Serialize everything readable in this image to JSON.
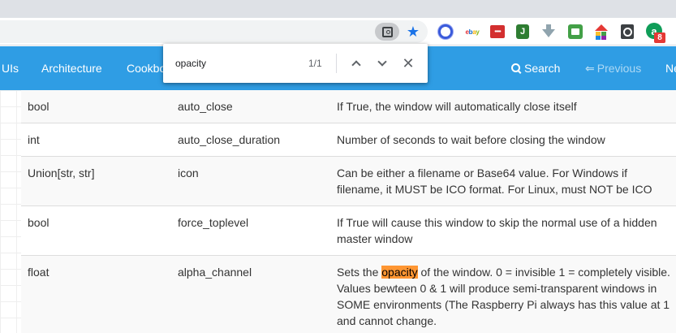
{
  "browser": {
    "find_query": "opacity",
    "find_count": "1/1",
    "badge_count": "8",
    "ext_green_letter": "J",
    "ext_a_letter": "a",
    "ebay_letters": [
      "e",
      "b",
      "a",
      "y"
    ]
  },
  "nav": {
    "item_uis": "UIs",
    "item_architecture": "Architecture",
    "item_cookbook": "Cookbook",
    "search_label": "Search",
    "previous_label": "Previous",
    "next_label": "Next"
  },
  "table": {
    "rows": [
      {
        "type": "bool",
        "name": "auto_close",
        "desc": "If True, the window will automatically close itself"
      },
      {
        "type": "int",
        "name": "auto_close_duration",
        "desc": "Number of seconds to wait before closing the window"
      },
      {
        "type": "Union[str, str]",
        "name": "icon",
        "desc": "Can be either a filename or Base64 value. For Windows if filename, it MUST be ICO format. For Linux, must NOT be ICO"
      },
      {
        "type": "bool",
        "name": "force_toplevel",
        "desc": "If True will cause this window to skip the normal use of a hidden master window"
      },
      {
        "type": "float",
        "name": "alpha_channel",
        "desc_before": "Sets the ",
        "desc_highlight": "opacity",
        "desc_after": " of the window. 0 = invisible 1 = completely visible. Values bewteen 0 & 1 will produce semi-transparent windows in SOME environments (The Raspberry Pi always has this value at 1 and cannot change."
      }
    ]
  },
  "colors": {
    "navbar": "#2f9de4",
    "find_highlight": "#ff9632",
    "star": "#1a73e8"
  }
}
